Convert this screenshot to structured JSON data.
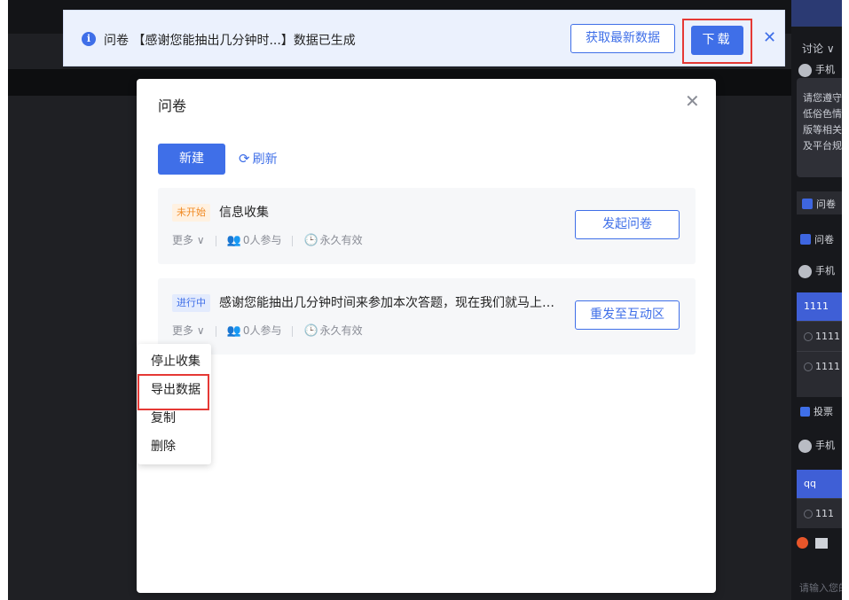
{
  "banner": {
    "prefix": "问卷",
    "survey_name": "【感谢您能抽出几分钟时...】",
    "suffix": "数据已生成",
    "refresh_label": "获取最新数据",
    "download_label": "下载",
    "close_icon": "close-icon"
  },
  "modal": {
    "title": "问卷",
    "new_label": "新建",
    "refresh_label": "刷新",
    "close_icon": "close-icon"
  },
  "surveys": [
    {
      "status": "未开始",
      "title": "信息收集",
      "more_label": "更多",
      "participants": "0人参与",
      "validity": "永久有效",
      "action_label": "发起问卷"
    },
    {
      "status": "进行中",
      "title": "感谢您能抽出几分钟时间来参加本次答题，现在我们就马上…",
      "more_label": "更多",
      "participants": "0人参与",
      "validity": "永久有效",
      "action_label": "重发至互动区"
    }
  ],
  "dropdown": {
    "items": [
      "停止收集",
      "导出数据",
      "复制",
      "删除"
    ]
  },
  "sidebar": {
    "tab_label": "讨论",
    "notice_lines": [
      "请您遵守",
      "低俗色情",
      "版等相关",
      "及平台规"
    ],
    "question_label": "问卷",
    "question_label_2": "问卷",
    "user_label": "手机",
    "card1_header": "1111",
    "card1_options": [
      "1111",
      "1111"
    ],
    "vote_label": "投票",
    "card2_header": "qq",
    "card2_option": "111",
    "input_placeholder": "请输入您的"
  },
  "colors": {
    "primary": "#3f6fe8",
    "highlight": "#e53935",
    "pending": "#f08a24",
    "banner_bg": "#ebf1fd"
  }
}
